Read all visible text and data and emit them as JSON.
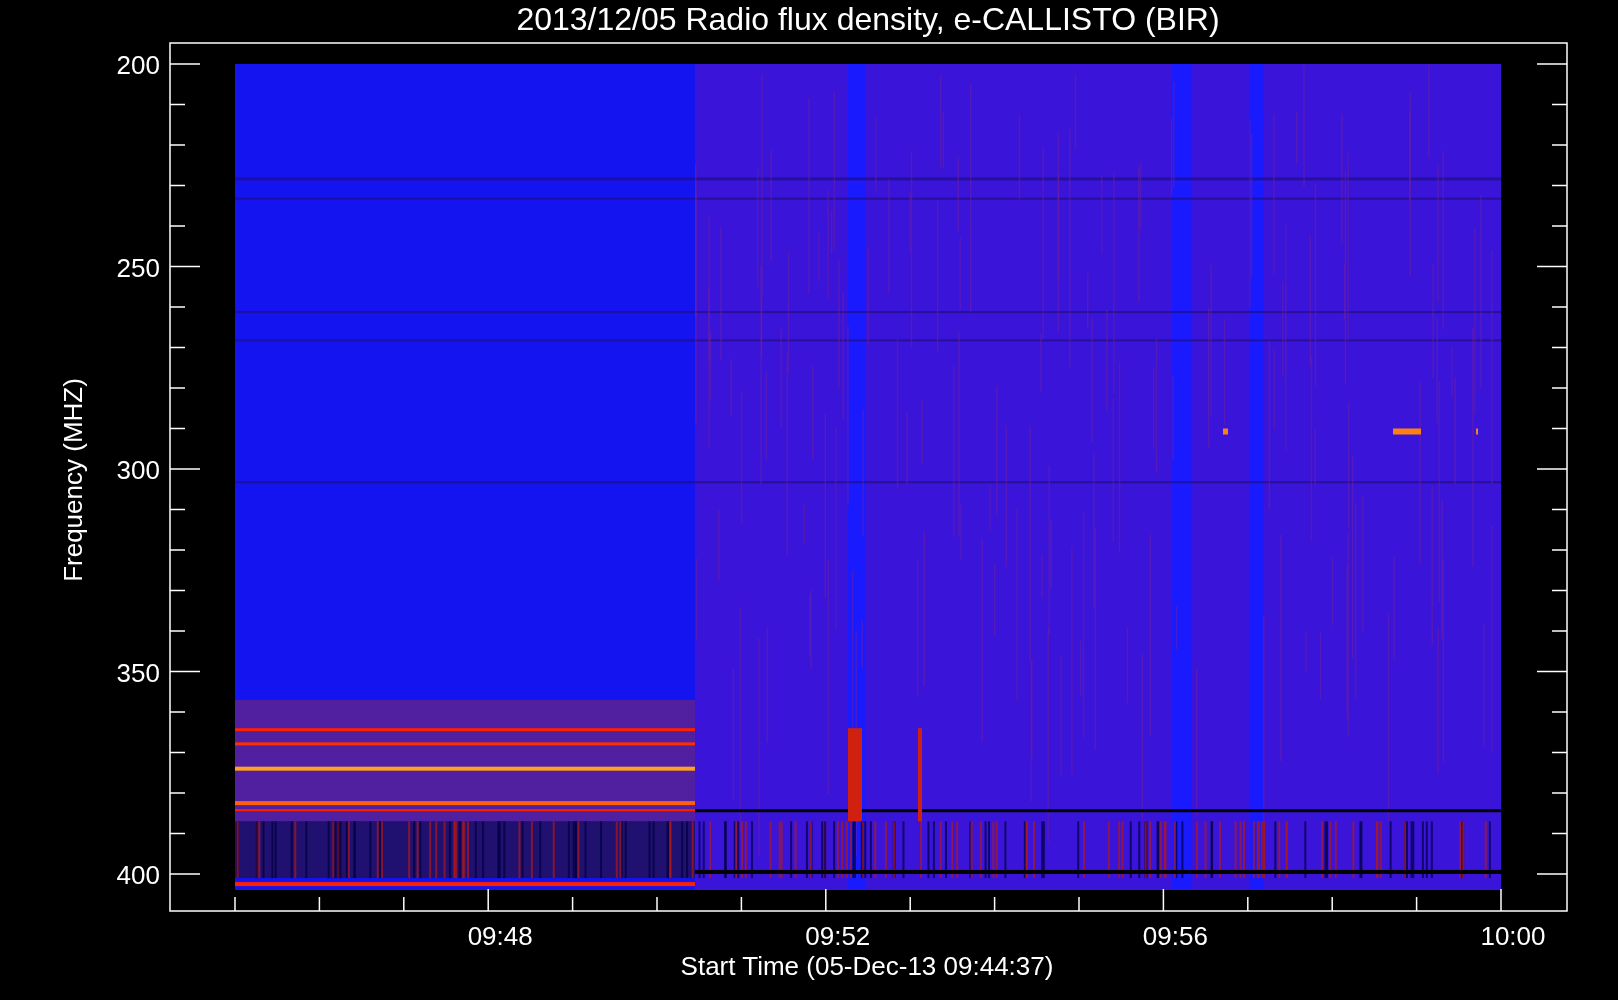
{
  "title": "2013/12/05  Radio flux density, e-CALLISTO (BIR)",
  "y_axis": {
    "label": "Frequency (MHZ)",
    "ticks": [
      "200",
      "250",
      "300",
      "350",
      "400"
    ]
  },
  "x_axis": {
    "label": "Start Time (05-Dec-13 09:44:37)",
    "ticks": [
      "09:48",
      "09:52",
      "09:56",
      "10:00"
    ]
  }
}
